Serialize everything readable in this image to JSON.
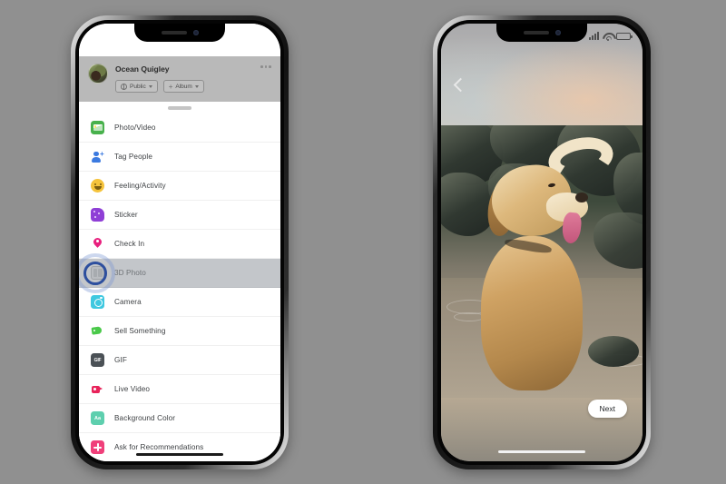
{
  "background_color": "#909090",
  "left_phone": {
    "name": "facebook-composer-phone",
    "status_bar": {
      "visible": false
    },
    "composer": {
      "user_name": "Ocean Quigley",
      "avatar_name": "user-avatar",
      "more_label": "•••",
      "chips": [
        {
          "label": "Public",
          "icon": "globe-icon",
          "has_caret": true,
          "has_plus": false
        },
        {
          "label": "Album",
          "icon": "plus-icon",
          "has_caret": true,
          "has_plus": true
        }
      ]
    },
    "sheet": {
      "grab_handle": "drag-handle",
      "items": [
        {
          "label": "Photo/Video",
          "icon": "photo-video-icon",
          "icon_color": "#48b14c",
          "selected": false
        },
        {
          "label": "Tag People",
          "icon": "tag-people-icon",
          "icon_color": "#3b7ae0",
          "selected": false
        },
        {
          "label": "Feeling/Activity",
          "icon": "feeling-activity-icon",
          "icon_color": "#f5c33b",
          "selected": false
        },
        {
          "label": "Sticker",
          "icon": "sticker-icon",
          "icon_color": "#8f3fd6",
          "selected": false
        },
        {
          "label": "Check In",
          "icon": "check-in-icon",
          "icon_color": "#e8207e",
          "selected": false
        },
        {
          "label": "3D Photo",
          "icon": "3d-photo-icon",
          "icon_color": "#b9bcc0",
          "selected": true
        },
        {
          "label": "Camera",
          "icon": "camera-icon",
          "icon_color": "#3fc8e0",
          "selected": false
        },
        {
          "label": "Sell Something",
          "icon": "sell-something-icon",
          "icon_color": "#4ac94a",
          "selected": false
        },
        {
          "label": "GIF",
          "icon": "gif-icon",
          "icon_color": "#4b5156",
          "selected": false
        },
        {
          "label": "Live Video",
          "icon": "live-video-icon",
          "icon_color": "#e8235a",
          "selected": false
        },
        {
          "label": "Background Color",
          "icon": "background-color-icon",
          "icon_color": "#5ecfae",
          "selected": false
        },
        {
          "label": "Ask for Recommendations",
          "icon": "ask-recommendations-icon",
          "icon_color": "#f0407a",
          "selected": false
        }
      ],
      "tap_indicator": {
        "on_item": "3D Photo",
        "ring_color": "#2d4f9e"
      }
    }
  },
  "right_phone": {
    "name": "3d-photo-preview-phone",
    "status_bar": {
      "signal_icon": "cellular-signal-icon",
      "wifi_icon": "wifi-icon",
      "battery_icon": "battery-icon"
    },
    "back_button_icon": "back-chevron-icon",
    "photo": {
      "subject": "golden retriever standing in shallow water",
      "alt": "3D photo preview of a golden retriever in a creek with mossy rocks"
    },
    "next_button_label": "Next",
    "home_indicator": "home-indicator"
  }
}
